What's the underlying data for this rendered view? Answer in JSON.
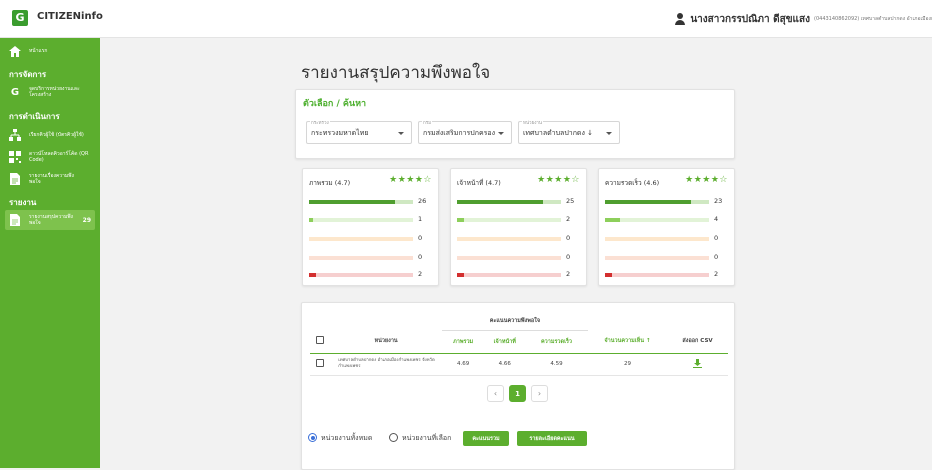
{
  "header": {
    "logo_letter": "G",
    "app_name": "CITIZENinfo",
    "user_name": "นางสาวกรรปณิภา ดีสุขแสง",
    "user_meta": "(0443140862092) เทศบาลตำบลปากดง อำเภอเมืองกำแพงเพชร จังหวัดกำแพงเพชร)"
  },
  "sidebar": {
    "home": "หน้าแรก",
    "section_manage": "การจัดการ",
    "service_points": "จุดบริการหน่วยงานและโครงสร้าง",
    "section_operate": "การดำเนินการ",
    "counter": "เรียกคิวผู้ใช้ (บัตรคิวผู้ใช้)",
    "qrcode": "ดาวน์โหลดคิวอาร์โค้ด (QR Code)",
    "survey": "รายงานเรื่องความพึงพอใจ",
    "section_report": "รายงาน",
    "report_summary": "รายงานสรุปความพึงพอใจ",
    "report_badge": "29"
  },
  "page_title": "รายงานสรุปความพึงพอใจ",
  "filter": {
    "title": "ตัวเลือก / ค้นหา",
    "ministry_caption": "กระทรวง",
    "ministry_value": "กระทรวงมหาดไทย",
    "dept_caption": "กรม",
    "dept_value": "กรมส่งเสริมการปกครอง",
    "agency_caption": "หน่วยงาน",
    "agency_value": "เทศบาลตำบลปากดง ↓"
  },
  "stats": [
    {
      "label": "ภาพรวม (4.7)",
      "stars": "★★★★☆",
      "counts": [
        26,
        1,
        0,
        0,
        2
      ]
    },
    {
      "label": "เจ้าหน้าที่ (4.7)",
      "stars": "★★★★☆",
      "counts": [
        25,
        2,
        0,
        0,
        2
      ]
    },
    {
      "label": "ความรวดเร็ว (4.6)",
      "stars": "★★★★☆",
      "counts": [
        23,
        4,
        0,
        0,
        2
      ]
    }
  ],
  "bar_colors": {
    "fill": [
      "#4f9e2f",
      "#8dcf5b",
      "#f2b36b",
      "#f28b6b",
      "#d32f2f"
    ],
    "track": [
      "#cfe8c2",
      "#e2f3d7",
      "#fde7cc",
      "#fbe0d4",
      "#f6cfcf"
    ]
  },
  "table": {
    "group_header": "คะแนนความพึงพอใจ",
    "col_agency": "หน่วยงาน",
    "col_overall": "ภาพรวม",
    "col_staff": "เจ้าหน้าที่",
    "col_speed": "ความรวดเร็ว",
    "col_count": "จำนวนความเห็น ↑",
    "col_export": "ส่งออก CSV",
    "row": {
      "agency": "เทศบาลตำบลปากดง อำเภอเมืองกำแพงเพชร จังหวัดกำแพงเพชร",
      "overall": "4.69",
      "staff": "4.66",
      "speed": "4.59",
      "count": "29"
    }
  },
  "pagination": {
    "prev": "‹",
    "current": "1",
    "next": "›"
  },
  "bottom": {
    "radio_all": "หน่วยงานทั้งหมด",
    "radio_selected": "หน่วยงานที่เลือก",
    "btn_score": "คะแนนรวม",
    "btn_detail": "รายละเอียดคะแนน"
  }
}
